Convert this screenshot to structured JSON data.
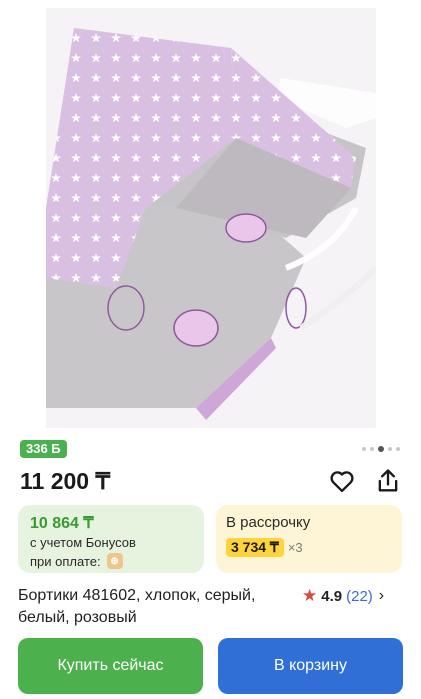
{
  "product": {
    "bonus_badge": "336 Б",
    "price": "11 200 ₸",
    "title": "Бортики 481602, хлопок, серый, белый, розовый"
  },
  "gallery": {
    "total_images": 5,
    "active_index": 2
  },
  "bonus_card": {
    "price": "10 864 ₸",
    "line1": "с учетом Бонусов",
    "line2": "при оплате:"
  },
  "installment_card": {
    "title": "В рассрочку",
    "amount": "3 734 ₸",
    "multiplier": "×3"
  },
  "rating": {
    "score": "4.9",
    "count": "(22)"
  },
  "buttons": {
    "buy_now": "Купить сейчас",
    "add_to_cart": "В корзину"
  },
  "colors": {
    "bonus_badge": "#4caf50",
    "bonus_card_bg": "#e6f4df",
    "installment_card_bg": "#fdf5d6",
    "installment_highlight": "#ffd43a",
    "buy_button": "#4cb04d",
    "cart_button": "#2f6fd6",
    "rating_star": "#e0473a",
    "rating_count": "#3a6bd8"
  },
  "icons": {
    "favorite": "heart-icon",
    "share": "share-icon",
    "bonus_coin": "coin-icon",
    "rating": "star-icon",
    "more": "chevron-right-icon"
  }
}
